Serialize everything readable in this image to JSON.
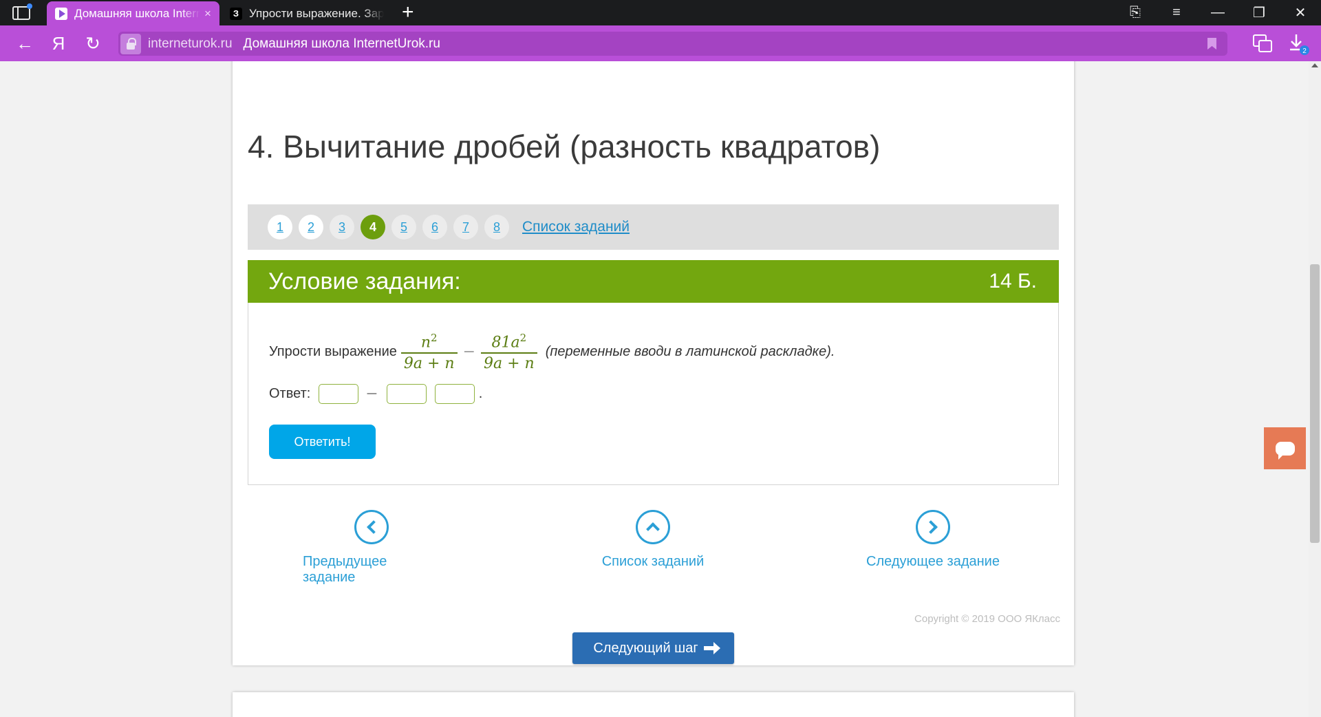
{
  "browser": {
    "tabs": [
      {
        "label": "Домашняя школа Intern",
        "close": "×",
        "active": true
      },
      {
        "label": "Упрости выражение. Зара",
        "favicon_text": "З",
        "active": false
      }
    ],
    "new_tab": "+",
    "window_controls": {
      "bookmarks_panel": "⎘",
      "menu": "≡",
      "minimize": "—",
      "restore": "❐",
      "close": "✕"
    },
    "address": {
      "domain": "interneturok.ru",
      "page_title": "Домашняя школа InternetUrok.ru"
    },
    "nav": {
      "back": "←",
      "yandex": "Я",
      "reload": "↻"
    },
    "download_badge": "2",
    "accent_color": "#b94fd8"
  },
  "page": {
    "title": "4. Вычитание дробей (разность квадратов)",
    "pager": {
      "items": [
        "1",
        "2",
        "3",
        "4",
        "5",
        "6",
        "7",
        "8"
      ],
      "active": "4",
      "list_link": "Список заданий"
    },
    "condition": {
      "heading": "Условие задания:",
      "points": "14 Б.",
      "prompt": "Упрости выражение",
      "fraction1": {
        "num": "n",
        "num_exp": "2",
        "den": "9a + n"
      },
      "minus": "−",
      "fraction2": {
        "num": "81a",
        "num_exp": "2",
        "den": "9a + n"
      },
      "hint": "(переменные вводи в латинской раскладке)."
    },
    "answer": {
      "label": "Ответ:",
      "minus": "−",
      "dot": ".",
      "fields": [
        "",
        "",
        ""
      ]
    },
    "submit_label": "Ответить!",
    "nav_links": {
      "prev": "Предыдущее задание",
      "list": "Список заданий",
      "next": "Следующее задание"
    },
    "copyright": "Copyright © 2019 ООО ЯКласс",
    "next_step": "Следующий шаг"
  },
  "colors": {
    "green": "#73a70f",
    "blue": "#2b9fd6",
    "button_blue": "#00a6e8",
    "chat": "#e67a55"
  }
}
